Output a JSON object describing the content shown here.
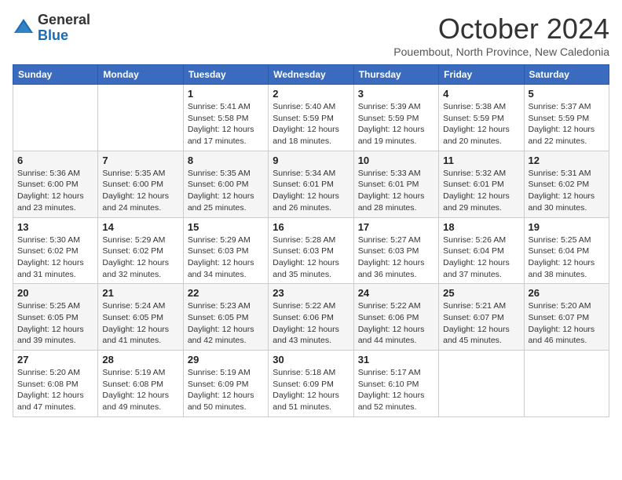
{
  "header": {
    "logo_general": "General",
    "logo_blue": "Blue",
    "month_title": "October 2024",
    "subtitle": "Pouembout, North Province, New Caledonia"
  },
  "days_of_week": [
    "Sunday",
    "Monday",
    "Tuesday",
    "Wednesday",
    "Thursday",
    "Friday",
    "Saturday"
  ],
  "weeks": [
    [
      {
        "num": "",
        "info": ""
      },
      {
        "num": "",
        "info": ""
      },
      {
        "num": "1",
        "info": "Sunrise: 5:41 AM\nSunset: 5:58 PM\nDaylight: 12 hours and 17 minutes."
      },
      {
        "num": "2",
        "info": "Sunrise: 5:40 AM\nSunset: 5:59 PM\nDaylight: 12 hours and 18 minutes."
      },
      {
        "num": "3",
        "info": "Sunrise: 5:39 AM\nSunset: 5:59 PM\nDaylight: 12 hours and 19 minutes."
      },
      {
        "num": "4",
        "info": "Sunrise: 5:38 AM\nSunset: 5:59 PM\nDaylight: 12 hours and 20 minutes."
      },
      {
        "num": "5",
        "info": "Sunrise: 5:37 AM\nSunset: 5:59 PM\nDaylight: 12 hours and 22 minutes."
      }
    ],
    [
      {
        "num": "6",
        "info": "Sunrise: 5:36 AM\nSunset: 6:00 PM\nDaylight: 12 hours and 23 minutes."
      },
      {
        "num": "7",
        "info": "Sunrise: 5:35 AM\nSunset: 6:00 PM\nDaylight: 12 hours and 24 minutes."
      },
      {
        "num": "8",
        "info": "Sunrise: 5:35 AM\nSunset: 6:00 PM\nDaylight: 12 hours and 25 minutes."
      },
      {
        "num": "9",
        "info": "Sunrise: 5:34 AM\nSunset: 6:01 PM\nDaylight: 12 hours and 26 minutes."
      },
      {
        "num": "10",
        "info": "Sunrise: 5:33 AM\nSunset: 6:01 PM\nDaylight: 12 hours and 28 minutes."
      },
      {
        "num": "11",
        "info": "Sunrise: 5:32 AM\nSunset: 6:01 PM\nDaylight: 12 hours and 29 minutes."
      },
      {
        "num": "12",
        "info": "Sunrise: 5:31 AM\nSunset: 6:02 PM\nDaylight: 12 hours and 30 minutes."
      }
    ],
    [
      {
        "num": "13",
        "info": "Sunrise: 5:30 AM\nSunset: 6:02 PM\nDaylight: 12 hours and 31 minutes."
      },
      {
        "num": "14",
        "info": "Sunrise: 5:29 AM\nSunset: 6:02 PM\nDaylight: 12 hours and 32 minutes."
      },
      {
        "num": "15",
        "info": "Sunrise: 5:29 AM\nSunset: 6:03 PM\nDaylight: 12 hours and 34 minutes."
      },
      {
        "num": "16",
        "info": "Sunrise: 5:28 AM\nSunset: 6:03 PM\nDaylight: 12 hours and 35 minutes."
      },
      {
        "num": "17",
        "info": "Sunrise: 5:27 AM\nSunset: 6:03 PM\nDaylight: 12 hours and 36 minutes."
      },
      {
        "num": "18",
        "info": "Sunrise: 5:26 AM\nSunset: 6:04 PM\nDaylight: 12 hours and 37 minutes."
      },
      {
        "num": "19",
        "info": "Sunrise: 5:25 AM\nSunset: 6:04 PM\nDaylight: 12 hours and 38 minutes."
      }
    ],
    [
      {
        "num": "20",
        "info": "Sunrise: 5:25 AM\nSunset: 6:05 PM\nDaylight: 12 hours and 39 minutes."
      },
      {
        "num": "21",
        "info": "Sunrise: 5:24 AM\nSunset: 6:05 PM\nDaylight: 12 hours and 41 minutes."
      },
      {
        "num": "22",
        "info": "Sunrise: 5:23 AM\nSunset: 6:05 PM\nDaylight: 12 hours and 42 minutes."
      },
      {
        "num": "23",
        "info": "Sunrise: 5:22 AM\nSunset: 6:06 PM\nDaylight: 12 hours and 43 minutes."
      },
      {
        "num": "24",
        "info": "Sunrise: 5:22 AM\nSunset: 6:06 PM\nDaylight: 12 hours and 44 minutes."
      },
      {
        "num": "25",
        "info": "Sunrise: 5:21 AM\nSunset: 6:07 PM\nDaylight: 12 hours and 45 minutes."
      },
      {
        "num": "26",
        "info": "Sunrise: 5:20 AM\nSunset: 6:07 PM\nDaylight: 12 hours and 46 minutes."
      }
    ],
    [
      {
        "num": "27",
        "info": "Sunrise: 5:20 AM\nSunset: 6:08 PM\nDaylight: 12 hours and 47 minutes."
      },
      {
        "num": "28",
        "info": "Sunrise: 5:19 AM\nSunset: 6:08 PM\nDaylight: 12 hours and 49 minutes."
      },
      {
        "num": "29",
        "info": "Sunrise: 5:19 AM\nSunset: 6:09 PM\nDaylight: 12 hours and 50 minutes."
      },
      {
        "num": "30",
        "info": "Sunrise: 5:18 AM\nSunset: 6:09 PM\nDaylight: 12 hours and 51 minutes."
      },
      {
        "num": "31",
        "info": "Sunrise: 5:17 AM\nSunset: 6:10 PM\nDaylight: 12 hours and 52 minutes."
      },
      {
        "num": "",
        "info": ""
      },
      {
        "num": "",
        "info": ""
      }
    ]
  ]
}
